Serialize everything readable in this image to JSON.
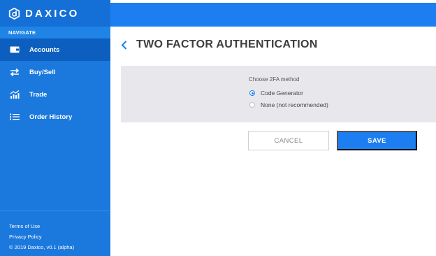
{
  "brand": {
    "name": "DAXICO"
  },
  "sidebar": {
    "section_label": "NAVIGATE",
    "items": [
      {
        "label": "Accounts",
        "icon": "wallet-icon",
        "active": true
      },
      {
        "label": "Buy/Sell",
        "icon": "swap-arrows-icon",
        "active": false
      },
      {
        "label": "Trade",
        "icon": "trade-chart-icon",
        "active": false
      },
      {
        "label": "Order History",
        "icon": "list-icon",
        "active": false
      }
    ],
    "footer": {
      "terms": "Terms of Use",
      "privacy": "Privacy Policy",
      "copyright": "© 2019 Daxico, v0.1 (alpha)"
    }
  },
  "page": {
    "title": "TWO FACTOR AUTHENTICATION",
    "method_label": "Choose 2FA method",
    "options": [
      {
        "label": "Code Generator",
        "checked": true
      },
      {
        "label": "None (not recommended)",
        "checked": false
      }
    ],
    "cancel_label": "CANCEL",
    "save_label": "SAVE"
  },
  "colors": {
    "sidebar": "#1b78dc",
    "sidebar_active": "#0d5fbf",
    "topbar": "#1c7ef0",
    "accent": "#1c7ef0",
    "panel": "#e8e8ec"
  }
}
